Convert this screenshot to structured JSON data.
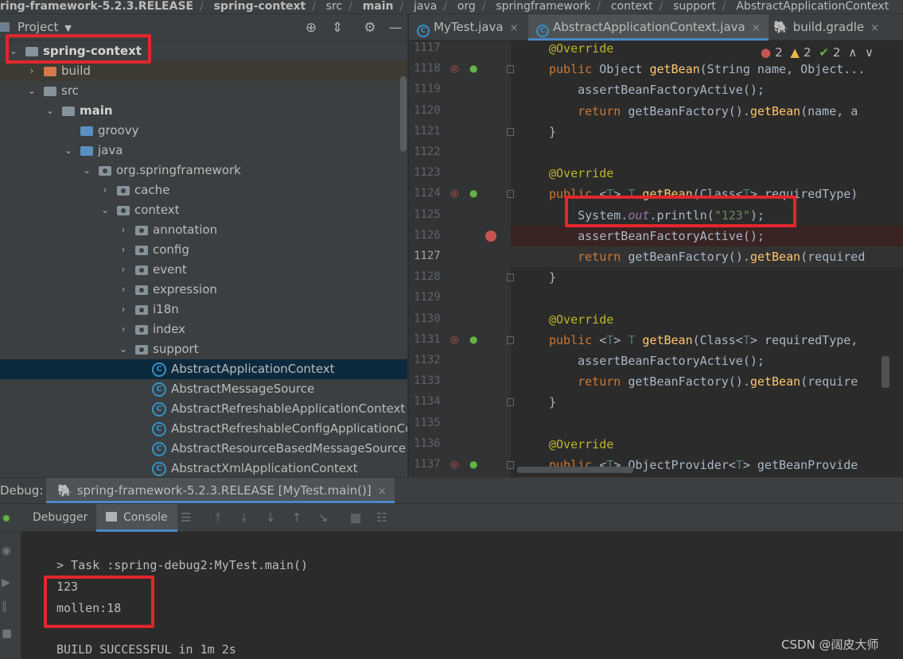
{
  "breadcrumb": [
    "ring-framework-5.2.3.RELEASE",
    "spring-context",
    "src",
    "main",
    "java",
    "org",
    "springframework",
    "context",
    "support",
    "AbstractApplicationContext"
  ],
  "project_panel": {
    "title": "Project",
    "tree": [
      {
        "label": "spring-context",
        "depth": 0,
        "expanded": true,
        "icon": "module-folder-icon",
        "bold": true
      },
      {
        "label": "build",
        "depth": 1,
        "expanded": false,
        "icon": "excluded-folder-icon"
      },
      {
        "label": "src",
        "depth": 1,
        "expanded": true,
        "icon": "folder-icon"
      },
      {
        "label": "main",
        "depth": 2,
        "expanded": true,
        "icon": "folder-icon",
        "bold": true
      },
      {
        "label": "groovy",
        "depth": 3,
        "icon": "source-folder-icon"
      },
      {
        "label": "java",
        "depth": 3,
        "expanded": true,
        "icon": "source-folder-icon"
      },
      {
        "label": "org.springframework",
        "depth": 4,
        "expanded": true,
        "icon": "package-icon"
      },
      {
        "label": "cache",
        "depth": 5,
        "expanded": false,
        "icon": "package-icon"
      },
      {
        "label": "context",
        "depth": 5,
        "expanded": true,
        "icon": "package-icon"
      },
      {
        "label": "annotation",
        "depth": 6,
        "expanded": false,
        "icon": "package-icon"
      },
      {
        "label": "config",
        "depth": 6,
        "expanded": false,
        "icon": "package-icon"
      },
      {
        "label": "event",
        "depth": 6,
        "expanded": false,
        "icon": "package-icon"
      },
      {
        "label": "expression",
        "depth": 6,
        "expanded": false,
        "icon": "package-icon"
      },
      {
        "label": "i18n",
        "depth": 6,
        "expanded": false,
        "icon": "package-icon"
      },
      {
        "label": "index",
        "depth": 6,
        "expanded": false,
        "icon": "package-icon"
      },
      {
        "label": "support",
        "depth": 6,
        "expanded": true,
        "icon": "package-icon"
      },
      {
        "label": "AbstractApplicationContext",
        "depth": 7,
        "icon": "class-icon",
        "selected": true
      },
      {
        "label": "AbstractMessageSource",
        "depth": 7,
        "icon": "class-icon"
      },
      {
        "label": "AbstractRefreshableApplicationContext",
        "depth": 7,
        "icon": "class-icon"
      },
      {
        "label": "AbstractRefreshableConfigApplicationCo",
        "depth": 7,
        "icon": "class-icon"
      },
      {
        "label": "AbstractResourceBasedMessageSource",
        "depth": 7,
        "icon": "class-icon"
      },
      {
        "label": "AbstractXmlApplicationContext",
        "depth": 7,
        "icon": "class-icon"
      }
    ]
  },
  "editor": {
    "tabs": [
      {
        "label": "MyTest.java",
        "icon": "class-icon",
        "active": false
      },
      {
        "label": "AbstractApplicationContext.java",
        "icon": "class-icon",
        "active": true
      },
      {
        "label": "build.gradle",
        "icon": "gradle-icon",
        "active": false
      }
    ],
    "inspections": {
      "errors": "2",
      "warnings": "2",
      "ok": "2"
    },
    "lines": [
      {
        "n": "1117",
        "text": "@Override"
      },
      {
        "n": "1118",
        "text": "public Object getBean(String name, Object..."
      },
      {
        "n": "1119",
        "text": "    assertBeanFactoryActive();"
      },
      {
        "n": "1120",
        "text": "    return getBeanFactory().getBean(name, a"
      },
      {
        "n": "1121",
        "text": "}"
      },
      {
        "n": "1122",
        "text": ""
      },
      {
        "n": "1123",
        "text": "@Override"
      },
      {
        "n": "1124",
        "text": "public <T> T getBean(Class<T> requiredType)"
      },
      {
        "n": "1125",
        "text": "    System.out.println(\"123\");"
      },
      {
        "n": "1126",
        "text": "    assertBeanFactoryActive();"
      },
      {
        "n": "1127",
        "text": "    return getBeanFactory().getBean(required"
      },
      {
        "n": "1128",
        "text": "}"
      },
      {
        "n": "1129",
        "text": ""
      },
      {
        "n": "1130",
        "text": "@Override"
      },
      {
        "n": "1131",
        "text": "public <T> T getBean(Class<T> requiredType,"
      },
      {
        "n": "1132",
        "text": "    assertBeanFactoryActive();"
      },
      {
        "n": "1133",
        "text": "    return getBeanFactory().getBean(require"
      },
      {
        "n": "1134",
        "text": "}"
      },
      {
        "n": "1135",
        "text": ""
      },
      {
        "n": "1136",
        "text": "@Override"
      },
      {
        "n": "1137",
        "text": "public <T> ObjectProvider<T> getBeanProvide"
      }
    ]
  },
  "debug": {
    "label": "Debug:",
    "session": "spring-framework-5.2.3.RELEASE [MyTest.main()]",
    "tabs": {
      "debugger": "Debugger",
      "console": "Console"
    },
    "console_lines": [
      "> Task :spring-debug2:MyTest.main()",
      "123",
      "mollen:18",
      "",
      "BUILD SUCCESSFUL in 1m 2s"
    ]
  },
  "watermark": "CSDN @阔皮大师",
  "colors": {
    "highlight_box": "#e3262c",
    "selection": "#0d293e",
    "accent_tab": "#4a88c7"
  }
}
